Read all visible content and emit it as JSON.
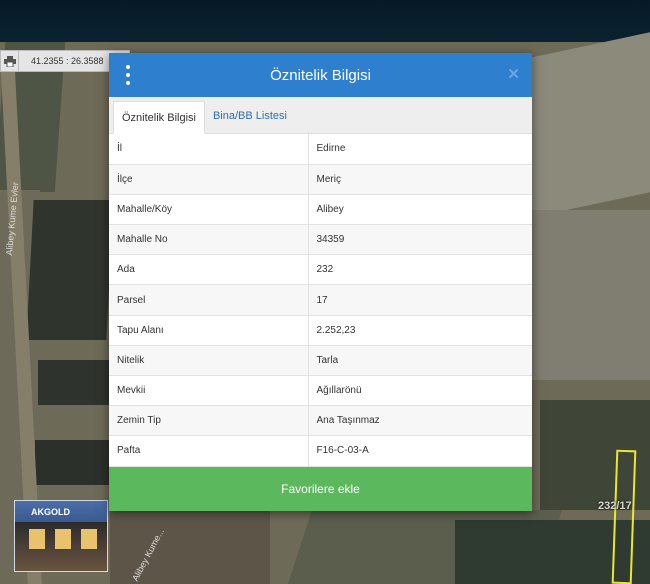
{
  "map": {
    "coordinates": "41.2355 : 26.3588",
    "parcel_label": "232/17",
    "road_label_left": "Alibey Kume Evler",
    "road_label_bottom": "Alibey Kume...",
    "thumbnail_logo": "AKGOLD",
    "print_icon": "printer-icon"
  },
  "dialog": {
    "title": "Öznitelik Bilgisi",
    "menu_icon": "kebab-menu-icon",
    "close_icon": "close-icon",
    "tabs": [
      {
        "label": "Öznitelik Bilgisi",
        "active": true
      },
      {
        "label": "Bina/BB Listesi",
        "active": false
      }
    ],
    "rows": [
      {
        "key": "İl",
        "value": "Edirne"
      },
      {
        "key": "İlçe",
        "value": "Meriç"
      },
      {
        "key": "Mahalle/Köy",
        "value": "Alibey"
      },
      {
        "key": "Mahalle No",
        "value": "34359"
      },
      {
        "key": "Ada",
        "value": "232"
      },
      {
        "key": "Parsel",
        "value": "17"
      },
      {
        "key": "Tapu Alanı",
        "value": "2.252,23"
      },
      {
        "key": "Nitelik",
        "value": "Tarla"
      },
      {
        "key": "Mevkii",
        "value": "Ağıllarönü"
      },
      {
        "key": "Zemin Tip",
        "value": "Ana Taşınmaz"
      },
      {
        "key": "Pafta",
        "value": "F16-C-03-A"
      }
    ],
    "favorite_button": "Favorilere ekle"
  },
  "colors": {
    "header": "#2e7fcd",
    "button": "#5cb85c",
    "tab_link": "#2e6fb2"
  }
}
